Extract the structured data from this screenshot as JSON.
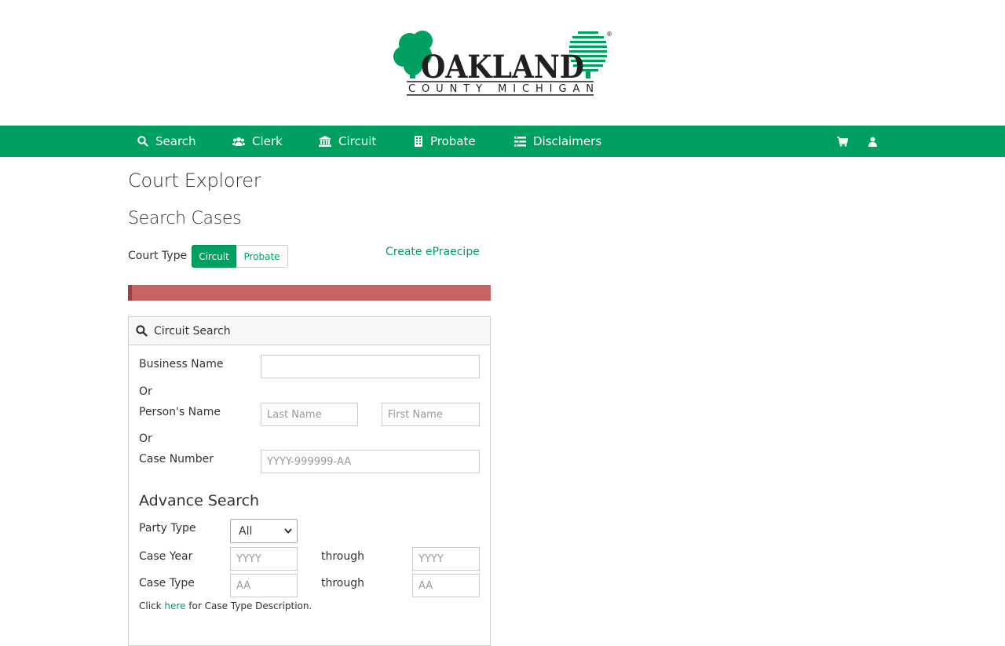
{
  "logo": {
    "line1": "OAKLAND",
    "line2": "COUNTY MICHIGAN",
    "registered": "®"
  },
  "nav": {
    "items": [
      {
        "label": "Search",
        "icon": "search-icon"
      },
      {
        "label": "Clerk",
        "icon": "users-icon"
      },
      {
        "label": "Circuit",
        "icon": "courthouse-icon"
      },
      {
        "label": "Probate",
        "icon": "building-icon"
      },
      {
        "label": "Disclaimers",
        "icon": "list-icon"
      }
    ],
    "right_icons": [
      "cart-icon",
      "user-icon"
    ]
  },
  "page": {
    "title": "Court Explorer",
    "subtitle": "Search Cases"
  },
  "court_type": {
    "label": "Court Type",
    "options": [
      "Circuit",
      "Probate"
    ],
    "selected": "Circuit"
  },
  "create_link": "Create ePraecipe",
  "panel": {
    "title": "Circuit Search",
    "business_name_label": "Business Name",
    "or1": "Or",
    "persons_name_label": "Person's Name",
    "last_name_placeholder": "Last Name",
    "first_name_placeholder": "First Name",
    "or2": "Or",
    "case_number_label": "Case Number",
    "case_number_placeholder": "YYYY-999999-AA",
    "advance_title": "Advance Search",
    "party_type_label": "Party Type",
    "party_type_value": "All",
    "case_year_label": "Case Year",
    "case_year_placeholder": "YYYY",
    "through1": "through",
    "case_year_to_placeholder": "YYYY",
    "case_type_label": "Case Type",
    "case_type_placeholder": "AA",
    "through2": "through",
    "case_type_to_placeholder": "AA",
    "hint_pre": "Click ",
    "hint_link": "here",
    "hint_post": " for Case Type Description."
  },
  "colors": {
    "brand": "#00a060",
    "alert": "#c46464",
    "text": "#333333"
  }
}
